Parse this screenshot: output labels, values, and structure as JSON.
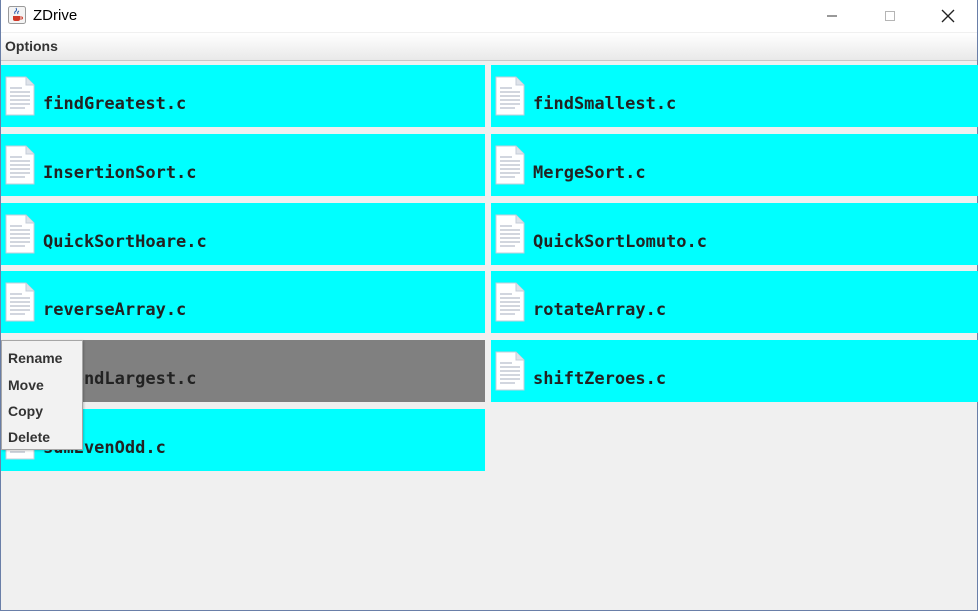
{
  "window": {
    "title": "ZDrive"
  },
  "menubar": {
    "options_label": "Options"
  },
  "files": [
    {
      "name": "findGreatest.c"
    },
    {
      "name": "findSmallest.c"
    },
    {
      "name": "InsertionSort.c"
    },
    {
      "name": "MergeSort.c"
    },
    {
      "name": "QuickSortHoare.c"
    },
    {
      "name": "QuickSortLomuto.c"
    },
    {
      "name": "reverseArray.c"
    },
    {
      "name": "rotateArray.c"
    },
    {
      "name": "secondLargest.c",
      "selected": true
    },
    {
      "name": "shiftZeroes.c"
    },
    {
      "name": "sumEvenOdd.c"
    }
  ],
  "context_menu": {
    "items": [
      "Rename",
      "Move",
      "Copy",
      "Delete"
    ]
  },
  "colors": {
    "tile": "#00ffff",
    "tile_selected": "#808080",
    "background": "#f0f0f0"
  },
  "icons": {
    "app": "java-coffee-icon",
    "file": "document-icon"
  }
}
